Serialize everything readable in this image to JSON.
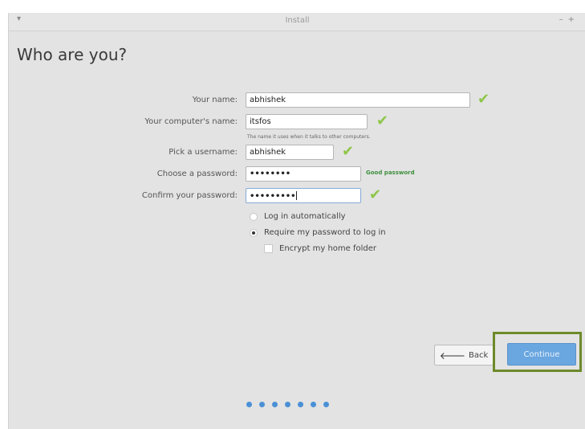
{
  "window": {
    "title": "Install"
  },
  "page": {
    "heading": "Who are you?"
  },
  "form": {
    "name_label": "Your name:",
    "name_value": "abhishek",
    "computer_label": "Your computer's name:",
    "computer_value": "itsfos",
    "computer_hint": "The name it uses when it talks to other computers.",
    "username_label": "Pick a username:",
    "username_value": "abhishek",
    "password_label": "Choose a password:",
    "password_value": "••••••••",
    "password_strength": "Good password",
    "confirm_label": "Confirm your password:",
    "confirm_value": "•••••••••"
  },
  "options": {
    "auto_login": "Log in automatically",
    "require_password": "Require my password to log in",
    "encrypt_home": "Encrypt my home folder"
  },
  "buttons": {
    "back": "Back",
    "continue": "Continue"
  },
  "progress": {
    "total_steps": 7
  },
  "colors": {
    "accent": "#6aa6df",
    "check": "#8fc64a",
    "highlight": "#6d8a2a",
    "progress_dot": "#4a90d6"
  },
  "icons": {
    "valid": "checkmark-icon",
    "back": "arrow-left-icon"
  }
}
